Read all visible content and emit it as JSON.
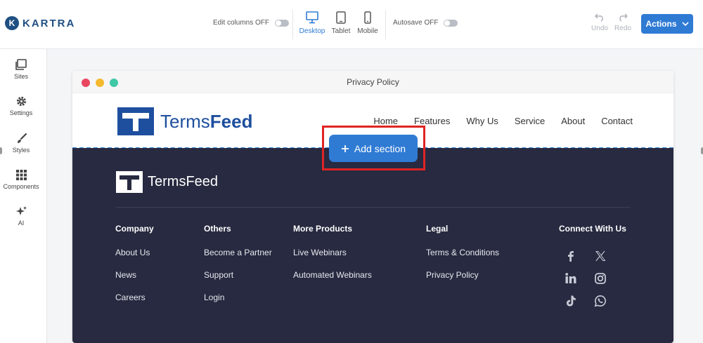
{
  "app": {
    "brand": "KARTRA",
    "logo_letter": "K"
  },
  "toolbar": {
    "edit_columns": "Edit columns OFF",
    "devices": [
      {
        "label": "Desktop",
        "icon": "monitor-icon",
        "active": true
      },
      {
        "label": "Tablet",
        "icon": "tablet-icon",
        "active": false
      },
      {
        "label": "Mobile",
        "icon": "mobile-icon",
        "active": false
      }
    ],
    "autosave": "Autosave OFF",
    "undo": "Undo",
    "redo": "Redo",
    "actions": "Actions"
  },
  "sidebar": {
    "items": [
      {
        "label": "Sites",
        "icon": "pages-icon"
      },
      {
        "label": "Settings",
        "icon": "gear-icon"
      },
      {
        "label": "Styles",
        "icon": "brush-icon"
      },
      {
        "label": "Components",
        "icon": "grid-icon"
      },
      {
        "label": "AI",
        "icon": "sparkle-icon"
      }
    ]
  },
  "preview": {
    "title": "Privacy Policy",
    "brand_light": "Terms",
    "brand_bold": "Feed",
    "nav": [
      "Home",
      "Features",
      "Why Us",
      "Service",
      "About",
      "Contact"
    ],
    "add_section": "Add section",
    "footer": {
      "brand": "TermsFeed",
      "columns": [
        {
          "heading": "Company",
          "links": [
            "About Us",
            "News",
            "Careers"
          ]
        },
        {
          "heading": "Others",
          "links": [
            "Become a Partner",
            "Support",
            "Login"
          ]
        },
        {
          "heading": "More Products",
          "links": [
            "Live Webinars",
            "Automated Webinars"
          ]
        },
        {
          "heading": "Legal",
          "links": [
            "Terms & Conditions",
            "Privacy Policy"
          ]
        },
        {
          "heading": "Connect With Us",
          "links": []
        }
      ],
      "social": [
        "facebook-icon",
        "x-icon",
        "linkedin-icon",
        "instagram-icon",
        "tiktok-icon",
        "whatsapp-icon"
      ]
    }
  },
  "colors": {
    "accent": "#2f7bd4",
    "brand": "#1e4f9e",
    "footer_bg": "#272a40",
    "highlight": "#e02424"
  }
}
